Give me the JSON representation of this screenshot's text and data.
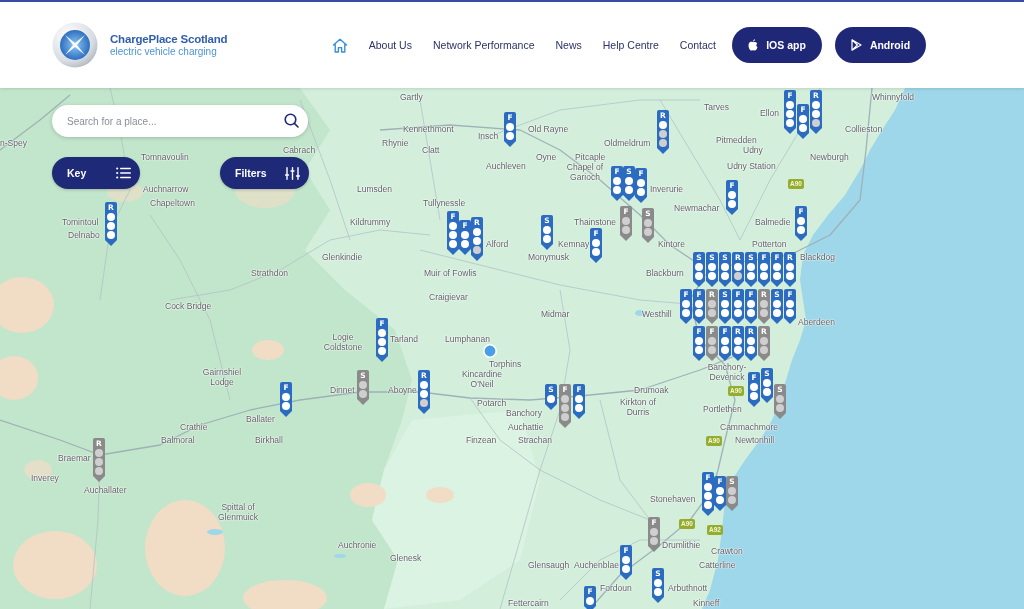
{
  "header": {
    "logo": {
      "title": "ChargePlace Scotland",
      "subtitle": "electric vehicle charging"
    },
    "nav": [
      {
        "kind": "home"
      },
      {
        "kind": "link",
        "label": "About Us"
      },
      {
        "kind": "link",
        "label": "Network Performance"
      },
      {
        "kind": "link",
        "label": "News"
      },
      {
        "kind": "link",
        "label": "Help Centre"
      },
      {
        "kind": "link",
        "label": "Contact"
      }
    ],
    "apps": [
      {
        "kind": "apple",
        "label": "IOS app"
      },
      {
        "kind": "play",
        "label": "Android"
      }
    ]
  },
  "map": {
    "search": {
      "placeholder": "Search for a place..."
    },
    "controls": [
      {
        "kind": "key",
        "label": "Key"
      },
      {
        "kind": "filters",
        "label": "Filters"
      }
    ],
    "places": [
      "Gartly",
      "Whinnyfold",
      "Tarves",
      "Ellon",
      "Kennethmont",
      "Old Rayne",
      "Collieston",
      "Insch",
      "n-Spey",
      "Rhynie",
      "Oldmeldrum",
      "Pitmedden",
      "Cabrach",
      "Clatt",
      "Udny",
      "Tomnavoulin",
      "Oyne",
      "Pitcaple",
      "Newburgh",
      "Auchleven",
      "Chapel of Garioch",
      "Udny Station",
      "Auchnarrow",
      "Lumsden",
      "Inverurie",
      "Chapeltown",
      "Tullynessle",
      "Newmachar",
      "Tomintoul",
      "Kildrummy",
      "Thainstone",
      "Balmedie",
      "Delnabo",
      "Alford",
      "Kemnay",
      "Kintore",
      "Potterton",
      "Glenkindie",
      "Monymusk",
      "Blackdog",
      "Strathdon",
      "Muir of Fowlis",
      "Blackburn",
      "Craigievar",
      "Cock Bridge",
      "Midmar",
      "Westhill",
      "Aberdeen",
      "Logie Coldstone",
      "Tarland",
      "Lumphanan",
      "Torphins",
      "Gairnshiel Lodge",
      "Kincardine O'Neil",
      "Banchory-Devenick",
      "Dinnet",
      "Aboyne",
      "Drumoak",
      "Potarch",
      "Banchory",
      "Kirkton of Durris",
      "Portlethen",
      "Ballater",
      "Crathie",
      "Auchattie",
      "Cammachmore",
      "Balmoral",
      "Birkhall",
      "Finzean",
      "Strachan",
      "Newtonhill",
      "Braemar",
      "Inverey",
      "Auchallater",
      "Stonehaven",
      "Spittal of Glenmuick",
      "Auchronie",
      "Drumlithie",
      "Crawton",
      "Glenesk",
      "Glensaugh",
      "Auchenblae",
      "Catterline",
      "Fordoun",
      "Arbuthnott",
      "Fettercairn",
      "Kinneff"
    ],
    "roads": [
      "A90",
      "A90",
      "A90",
      "A90",
      "A92"
    ],
    "chargers": [
      {
        "letter": "F",
        "color": "#2c6cc0",
        "connectors": [
          {
            "free": true
          },
          {
            "free": true
          }
        ]
      },
      {
        "letter": "R",
        "color": "#2c6cc0",
        "connectors": [
          {
            "free": true
          },
          {
            "free": false
          },
          {
            "free": false
          }
        ]
      },
      {
        "letter": "F",
        "color": "#2c6cc0",
        "connectors": [
          {
            "free": true
          },
          {
            "free": true
          },
          {
            "free": true
          }
        ]
      },
      {
        "letter": "F",
        "color": "#2c6cc0",
        "connectors": [
          {
            "free": true
          },
          {
            "free": true
          }
        ]
      },
      {
        "letter": "R",
        "color": "#2c6cc0",
        "connectors": [
          {
            "free": true
          },
          {
            "free": true
          },
          {
            "free": false
          }
        ]
      },
      {
        "letter": "F",
        "color": "#2c6cc0",
        "connectors": [
          {
            "free": true
          },
          {
            "free": true
          }
        ]
      },
      {
        "letter": "S",
        "color": "#2c6cc0",
        "connectors": [
          {
            "free": true
          },
          {
            "free": true
          }
        ]
      },
      {
        "letter": "F",
        "color": "#2c6cc0",
        "connectors": [
          {
            "free": true
          },
          {
            "free": true
          }
        ]
      },
      {
        "letter": "F",
        "color": "#2c6cc0",
        "connectors": [
          {
            "free": true
          },
          {
            "free": true
          }
        ]
      },
      {
        "letter": "R",
        "color": "#2c6cc0",
        "connectors": [
          {
            "free": true
          },
          {
            "free": true
          },
          {
            "free": true
          }
        ]
      },
      {
        "letter": "F",
        "color": "#2c6cc0",
        "connectors": [
          {
            "free": true
          },
          {
            "free": true
          },
          {
            "free": true
          }
        ]
      },
      {
        "letter": "F",
        "color": "#2c6cc0",
        "connectors": [
          {
            "free": true
          },
          {
            "free": true
          }
        ]
      },
      {
        "letter": "R",
        "color": "#2c6cc0",
        "connectors": [
          {
            "free": true
          },
          {
            "free": true
          },
          {
            "free": false
          }
        ]
      },
      {
        "letter": "S",
        "color": "#2c6cc0",
        "connectors": [
          {
            "free": true
          },
          {
            "free": true
          }
        ]
      },
      {
        "letter": "F",
        "color": "#8a8a8a",
        "connectors": [
          {
            "free": false
          },
          {
            "free": false
          }
        ]
      },
      {
        "letter": "S",
        "color": "#8a8a8a",
        "connectors": [
          {
            "free": false
          },
          {
            "free": false
          }
        ]
      },
      {
        "letter": "F",
        "color": "#2c6cc0",
        "connectors": [
          {
            "free": true
          },
          {
            "free": true
          }
        ]
      },
      {
        "letter": "F",
        "color": "#2c6cc0",
        "connectors": [
          {
            "free": true
          },
          {
            "free": true
          }
        ]
      },
      {
        "letter": "S",
        "color": "#2c6cc0",
        "connectors": [
          {
            "free": true
          },
          {
            "free": true
          }
        ]
      },
      {
        "letter": "S",
        "color": "#2c6cc0",
        "connectors": [
          {
            "free": true
          },
          {
            "free": true
          }
        ]
      },
      {
        "letter": "S",
        "color": "#2c6cc0",
        "connectors": [
          {
            "free": true
          },
          {
            "free": true
          }
        ]
      },
      {
        "letter": "R",
        "color": "#2c6cc0",
        "connectors": [
          {
            "free": true
          },
          {
            "free": false
          }
        ]
      },
      {
        "letter": "S",
        "color": "#2c6cc0",
        "connectors": [
          {
            "free": true
          },
          {
            "free": true
          }
        ]
      },
      {
        "letter": "F",
        "color": "#2c6cc0",
        "connectors": [
          {
            "free": true
          },
          {
            "free": true
          }
        ]
      },
      {
        "letter": "F",
        "color": "#2c6cc0",
        "connectors": [
          {
            "free": true
          },
          {
            "free": true
          }
        ]
      },
      {
        "letter": "R",
        "color": "#2c6cc0",
        "connectors": [
          {
            "free": true
          },
          {
            "free": true
          }
        ]
      },
      {
        "letter": "F",
        "color": "#2c6cc0",
        "connectors": [
          {
            "free": true
          },
          {
            "free": true
          }
        ]
      },
      {
        "letter": "F",
        "color": "#2c6cc0",
        "connectors": [
          {
            "free": true
          },
          {
            "free": true
          }
        ]
      },
      {
        "letter": "R",
        "color": "#8a8a8a",
        "connectors": [
          {
            "free": false
          },
          {
            "free": false
          }
        ]
      },
      {
        "letter": "S",
        "color": "#2c6cc0",
        "connectors": [
          {
            "free": true
          },
          {
            "free": true
          }
        ]
      },
      {
        "letter": "F",
        "color": "#2c6cc0",
        "connectors": [
          {
            "free": true
          },
          {
            "free": true
          }
        ]
      },
      {
        "letter": "F",
        "color": "#2c6cc0",
        "connectors": [
          {
            "free": true
          },
          {
            "free": true
          }
        ]
      },
      {
        "letter": "R",
        "color": "#8a8a8a",
        "connectors": [
          {
            "free": false
          },
          {
            "free": false
          }
        ]
      },
      {
        "letter": "S",
        "color": "#2c6cc0",
        "connectors": [
          {
            "free": true
          },
          {
            "free": true
          }
        ]
      },
      {
        "letter": "F",
        "color": "#2c6cc0",
        "connectors": [
          {
            "free": true
          },
          {
            "free": true
          }
        ]
      },
      {
        "letter": "F",
        "color": "#2c6cc0",
        "connectors": [
          {
            "free": true
          },
          {
            "free": true
          },
          {
            "free": true
          }
        ]
      },
      {
        "letter": "F",
        "color": "#2c6cc0",
        "connectors": [
          {
            "free": true
          },
          {
            "free": true
          }
        ]
      },
      {
        "letter": "F",
        "color": "#8a8a8a",
        "connectors": [
          {
            "free": false
          },
          {
            "free": false
          }
        ]
      },
      {
        "letter": "F",
        "color": "#2c6cc0",
        "connectors": [
          {
            "free": true
          },
          {
            "free": true
          }
        ]
      },
      {
        "letter": "R",
        "color": "#2c6cc0",
        "connectors": [
          {
            "free": true
          },
          {
            "free": true
          }
        ]
      },
      {
        "letter": "R",
        "color": "#2c6cc0",
        "connectors": [
          {
            "free": true
          },
          {
            "free": true
          }
        ]
      },
      {
        "letter": "R",
        "color": "#8a8a8a",
        "connectors": [
          {
            "free": false
          },
          {
            "free": false
          }
        ]
      },
      {
        "letter": "F",
        "color": "#2c6cc0",
        "connectors": [
          {
            "free": true
          },
          {
            "free": true
          }
        ]
      },
      {
        "letter": "S",
        "color": "#8a8a8a",
        "connectors": [
          {
            "free": false
          },
          {
            "free": false
          }
        ]
      },
      {
        "letter": "R",
        "color": "#2c6cc0",
        "connectors": [
          {
            "free": true
          },
          {
            "free": true
          },
          {
            "free": false
          }
        ]
      },
      {
        "letter": "S",
        "color": "#2c6cc0",
        "connectors": [
          {
            "free": true
          }
        ]
      },
      {
        "letter": "F",
        "color": "#8a8a8a",
        "connectors": [
          {
            "free": false
          },
          {
            "free": false
          },
          {
            "free": false
          }
        ]
      },
      {
        "letter": "F",
        "color": "#2c6cc0",
        "connectors": [
          {
            "free": true
          },
          {
            "free": true
          }
        ]
      },
      {
        "letter": "F",
        "color": "#2c6cc0",
        "connectors": [
          {
            "free": true
          },
          {
            "free": true
          }
        ]
      },
      {
        "letter": "S",
        "color": "#2c6cc0",
        "connectors": [
          {
            "free": true
          },
          {
            "free": true
          }
        ]
      },
      {
        "letter": "S",
        "color": "#8a8a8a",
        "connectors": [
          {
            "free": false
          },
          {
            "free": false
          }
        ]
      },
      {
        "letter": "R",
        "color": "#8a8a8a",
        "connectors": [
          {
            "free": false
          },
          {
            "free": false
          },
          {
            "free": false
          }
        ]
      },
      {
        "letter": "F",
        "color": "#2c6cc0",
        "connectors": [
          {
            "free": true
          },
          {
            "free": true
          },
          {
            "free": true
          }
        ]
      },
      {
        "letter": "F",
        "color": "#2c6cc0",
        "connectors": [
          {
            "free": true
          },
          {
            "free": true
          }
        ]
      },
      {
        "letter": "S",
        "color": "#8a8a8a",
        "connectors": [
          {
            "free": false
          },
          {
            "free": false
          }
        ]
      },
      {
        "letter": "F",
        "color": "#8a8a8a",
        "connectors": [
          {
            "free": false
          },
          {
            "free": false
          }
        ]
      },
      {
        "letter": "F",
        "color": "#2c6cc0",
        "connectors": [
          {
            "free": true
          },
          {
            "free": true
          }
        ]
      },
      {
        "letter": "F",
        "color": "#2c6cc0",
        "connectors": [
          {
            "free": true
          }
        ]
      },
      {
        "letter": "S",
        "color": "#2c6cc0",
        "connectors": [
          {
            "free": true
          },
          {
            "free": true
          }
        ]
      }
    ]
  }
}
